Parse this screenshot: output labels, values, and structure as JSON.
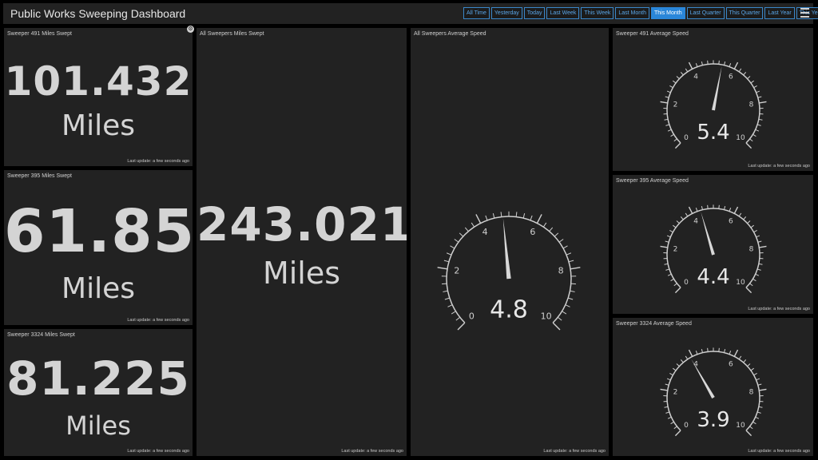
{
  "header": {
    "title": "Public Works Sweeping Dashboard",
    "filters": [
      "All Time",
      "Yesterday",
      "Today",
      "Last Week",
      "This Week",
      "Last Month",
      "This Month",
      "Last Quarter",
      "This Quarter",
      "Last Year",
      "This Year"
    ],
    "active_filter": "This Month"
  },
  "panels": {
    "s491_miles": {
      "title": "Sweeper 491 Miles Swept",
      "value": "101.432",
      "unit": "Miles",
      "footer": "Last update: a few seconds ago"
    },
    "s395_miles": {
      "title": "Sweeper 395 Miles Swept",
      "value": "61.85",
      "unit": "Miles",
      "footer": "Last update: a few seconds ago"
    },
    "s3324_miles": {
      "title": "Sweeper 3324 Miles Swept",
      "value": "81.225",
      "unit": "Miles",
      "footer": "Last update: a few seconds ago"
    },
    "all_miles": {
      "title": "All Sweepers Miles Swept",
      "value": "243.021",
      "unit": "Miles",
      "footer": "Last update: a few seconds ago"
    },
    "all_speed": {
      "title": "All Sweepers Average Speed",
      "value": "4.8",
      "footer": "Last update: a few seconds ago"
    },
    "s491_speed": {
      "title": "Sweeper 491 Average Speed",
      "value": "5.4",
      "footer": "Last update: a few seconds ago"
    },
    "s395_speed": {
      "title": "Sweeper 395 Average Speed",
      "value": "4.4",
      "footer": "Last update: a few seconds ago"
    },
    "s3324_speed": {
      "title": "Sweeper 3324 Average Speed",
      "value": "3.9",
      "footer": "Last update: a few seconds ago"
    }
  },
  "gauge_scale": {
    "min": 0,
    "max": 10,
    "labels": [
      "0",
      "2",
      "4",
      "6",
      "8",
      "10"
    ]
  },
  "colors": {
    "background": "#000000",
    "panel": "#222222",
    "accent": "#2a86d9",
    "text": "#d8d8d8"
  }
}
